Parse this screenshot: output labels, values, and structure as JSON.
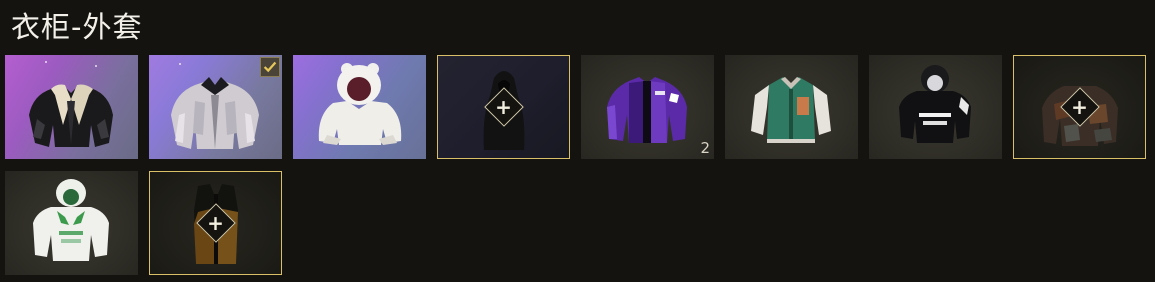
{
  "page": {
    "title": "衣柜-外套"
  },
  "colors": {
    "background": "#141310",
    "selected_border": "#d9c068",
    "text": "#f2f0e8"
  },
  "items": [
    {
      "name": "black-leather-shearling-jacket",
      "icon": "leather-jacket-icon",
      "equipped": false,
      "count": ""
    },
    {
      "name": "silver-metallic-jacket",
      "icon": "silver-jacket-icon",
      "equipped": true,
      "count": ""
    },
    {
      "name": "white-bear-hoodie",
      "icon": "bear-hoodie-icon",
      "equipped": false,
      "count": ""
    },
    {
      "name": "black-hooded-cloak",
      "icon": "cloak-icon",
      "equipped": false,
      "count": "",
      "add_slot": true
    },
    {
      "name": "purple-track-jacket",
      "icon": "purple-jacket-icon",
      "equipped": false,
      "count": "2"
    },
    {
      "name": "green-varsity-jacket",
      "icon": "varsity-jacket-icon",
      "equipped": false,
      "count": ""
    },
    {
      "name": "black-graphic-hoodie",
      "icon": "black-hoodie-icon",
      "equipped": false,
      "count": ""
    },
    {
      "name": "rust-camo-jacket",
      "icon": "camo-jacket-icon",
      "equipped": false,
      "count": "",
      "add_slot": true
    },
    {
      "name": "white-green-hoodie",
      "icon": "green-hoodie-icon",
      "equipped": false,
      "count": ""
    },
    {
      "name": "orange-black-vest",
      "icon": "vest-icon",
      "equipped": false,
      "count": "",
      "add_slot": true
    }
  ],
  "symbols": {
    "plus": "+",
    "check": "✓"
  }
}
